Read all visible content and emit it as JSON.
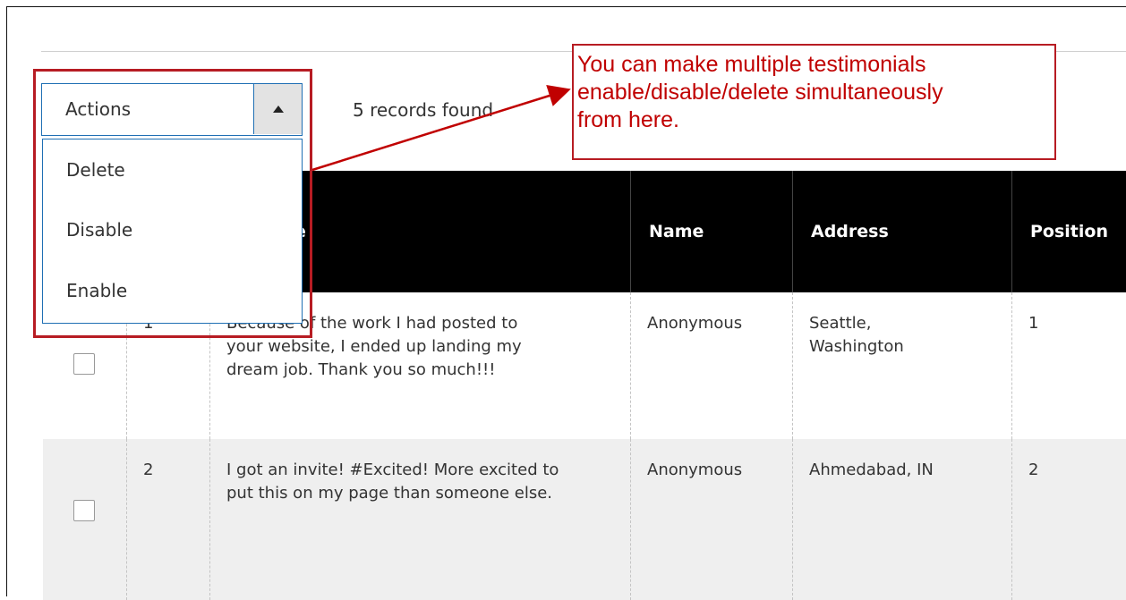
{
  "toolbar": {
    "actions_label": "Actions",
    "records_text": "5 records found",
    "menu_items": [
      "Delete",
      "Disable",
      "Enable"
    ]
  },
  "callout": {
    "lines": [
      "You can make multiple testimonials",
      "enable/disable/delete simultaneously",
      "from here."
    ]
  },
  "table": {
    "headers": {
      "testimonial_partial": "e",
      "name": "Name",
      "address": "Address",
      "position": "Position"
    },
    "rows": [
      {
        "id": "1",
        "testimonial_lines": [
          "Because of the work I had posted to",
          "your website, I ended up landing my",
          "dream job. Thank you so much!!!"
        ],
        "name": "Anonymous",
        "address_lines": [
          "Seattle,",
          "Washington"
        ],
        "position": "1"
      },
      {
        "id": "2",
        "testimonial_lines": [
          "I got an invite! #Excited! More excited to",
          "put this on my page than someone else."
        ],
        "name": "Anonymous",
        "address_lines": [
          "Ahmedabad, IN"
        ],
        "position": "2"
      }
    ]
  },
  "colors": {
    "annotation_red": "#c00000",
    "border_red": "#b71c23",
    "header_bg": "#000000",
    "row_alt_bg": "#efefef",
    "select_border": "#1f6fb4"
  }
}
